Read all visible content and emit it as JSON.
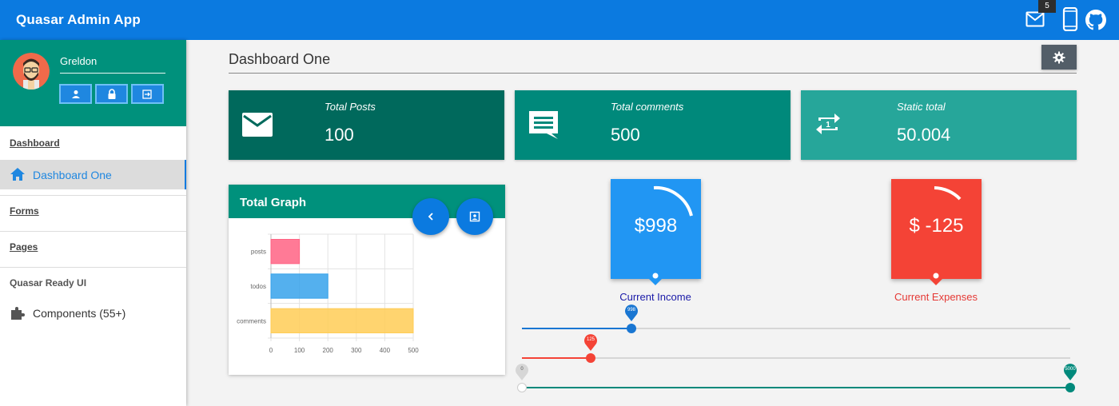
{
  "header": {
    "title": "Quasar Admin App",
    "mail_badge": "5",
    "icons": [
      "mail-icon",
      "phone-icon",
      "github-icon"
    ]
  },
  "sidebar": {
    "user_name": "Greldon",
    "profile_buttons": [
      "person-icon",
      "lock-icon",
      "logout-icon"
    ],
    "sections": {
      "dashboard": "Dashboard",
      "dashboard_one": "Dashboard One",
      "forms": "Forms",
      "pages": "Pages",
      "ready_ui": "Quasar Ready UI",
      "components": "Components (55+)"
    }
  },
  "main": {
    "title": "Dashboard One",
    "stats": [
      {
        "label": "Total Posts",
        "value": "100",
        "icon": "mail-icon",
        "color": "#00695c"
      },
      {
        "label": "Total comments",
        "value": "500",
        "icon": "comment-icon",
        "color": "#00897b"
      },
      {
        "label": "Static total",
        "value": "50.004",
        "icon": "repeat-one-icon",
        "color": "#26a69a"
      }
    ],
    "graph": {
      "title": "Total Graph",
      "fab_icons": [
        "chevron-left-icon",
        "contact-icon"
      ]
    },
    "income": {
      "value": "$998",
      "label": "Current Income",
      "color": "#2196f3"
    },
    "expenses": {
      "value": "$ -125",
      "label": "Current Expenses",
      "color": "#f44336"
    },
    "sliders": [
      {
        "value": "998",
        "fraction": 0.2,
        "color": "#1976d2"
      },
      {
        "value": "125",
        "fraction": 0.125,
        "color": "#f44336"
      },
      {
        "min_label": "0",
        "value": "5000",
        "fraction": 1.0,
        "color": "#00897b"
      }
    ]
  },
  "chart_data": {
    "type": "bar",
    "orientation": "horizontal",
    "categories": [
      "posts",
      "todos",
      "comments"
    ],
    "values": [
      100,
      200,
      500
    ],
    "colors": [
      "#ff6384",
      "#36a2eb",
      "#ffcd56"
    ],
    "xlim": [
      0,
      500
    ],
    "xticks": [
      "0",
      "100",
      "200",
      "300",
      "400",
      "500"
    ],
    "grid": true
  }
}
